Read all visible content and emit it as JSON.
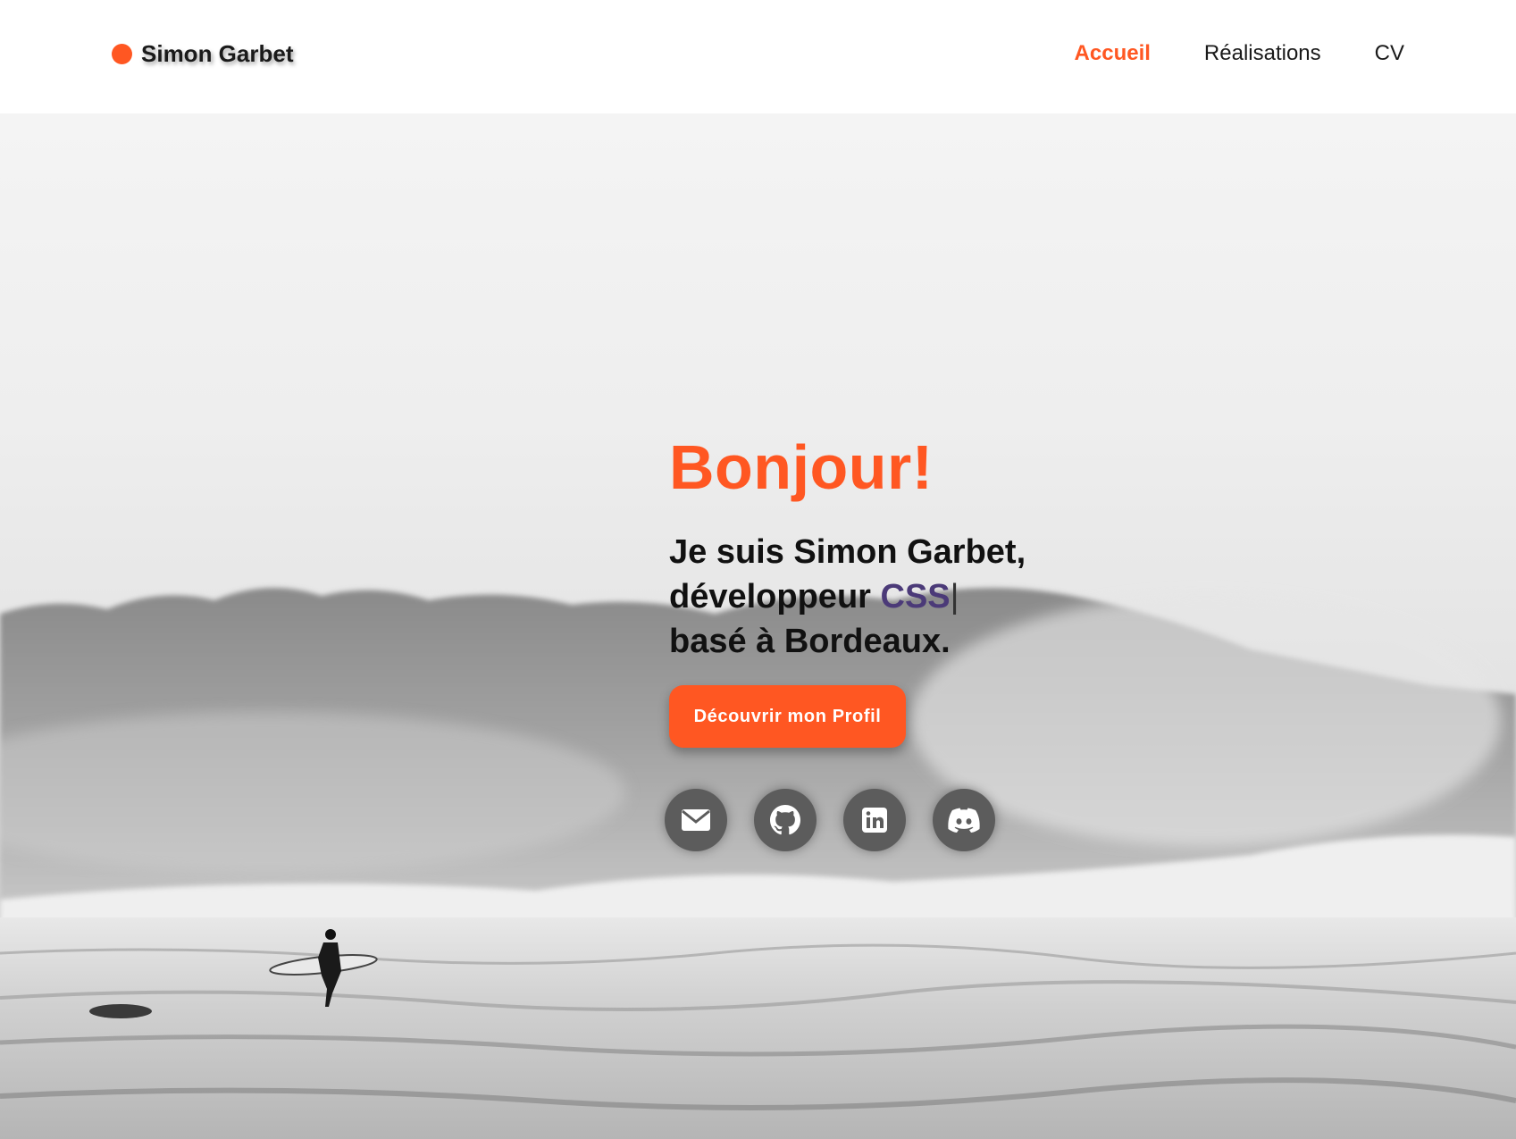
{
  "header": {
    "logo_text": "Simon Garbet",
    "nav": [
      {
        "label": "Accueil",
        "active": true
      },
      {
        "label": "Réalisations",
        "active": false
      },
      {
        "label": "CV",
        "active": false
      }
    ]
  },
  "hero": {
    "greeting": "Bonjour!",
    "intro_line1": "Je suis Simon Garbet,",
    "intro_line2_prefix": "développeur",
    "intro_highlight": "CSS",
    "intro_cursor": "|",
    "intro_line3": "basé à Bordeaux.",
    "cta_label": "Découvrir mon Profil",
    "socials": [
      {
        "icon": "envelope-icon"
      },
      {
        "icon": "github-icon"
      },
      {
        "icon": "linkedin-icon"
      },
      {
        "icon": "discord-icon"
      }
    ]
  },
  "colors": {
    "accent": "#ff5722",
    "highlight": "#4b3a78",
    "social_bg": "#5c5c5c"
  }
}
